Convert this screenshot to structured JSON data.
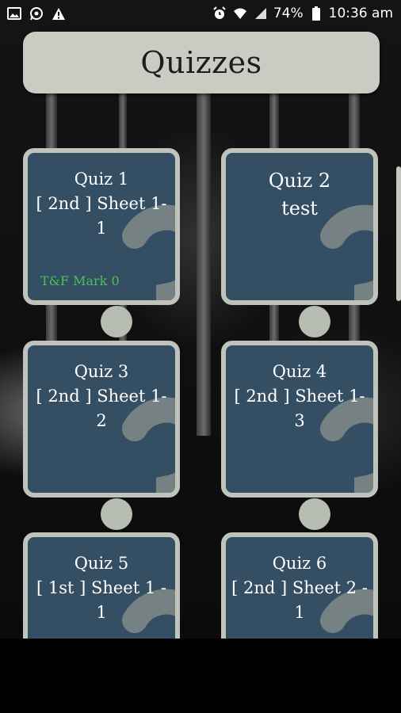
{
  "status_bar": {
    "battery": "74%",
    "time": "10:36 am",
    "left_icons": [
      "image-icon",
      "whatsapp-icon",
      "warning-icon"
    ],
    "right_icons": [
      "alarm-icon",
      "wifi-icon",
      "signal-icon",
      "battery-icon"
    ]
  },
  "header": {
    "title": "Quizzes"
  },
  "quizzes": [
    {
      "title": "Quiz 1",
      "subtitle": "[ 2nd ] Sheet 1-1",
      "mark": "T&F Mark 0"
    },
    {
      "title": "Quiz 2",
      "subtitle": "test",
      "mark": ""
    },
    {
      "title": "Quiz 3",
      "subtitle": "[ 2nd ] Sheet 1-2",
      "mark": ""
    },
    {
      "title": "Quiz 4",
      "subtitle": "[ 2nd ] Sheet 1-3",
      "mark": ""
    },
    {
      "title": "Quiz 5",
      "subtitle": "[ 1st ] Sheet 1 - 1",
      "mark": ""
    },
    {
      "title": "Quiz 6",
      "subtitle": "[ 2nd ] Sheet 2 - 1",
      "mark": ""
    }
  ],
  "colors": {
    "tile_bg": "#344e63",
    "tile_border": "#bfc3b9",
    "header_bg": "#c8ccc2",
    "mark_green": "#4fbf5a"
  }
}
